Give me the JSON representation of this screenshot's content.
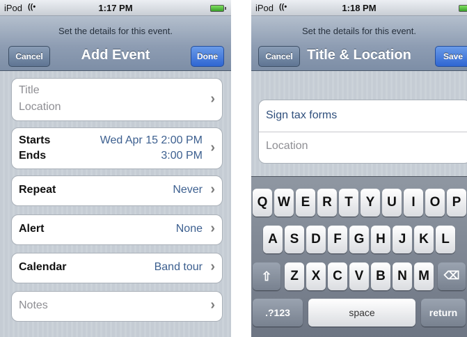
{
  "left": {
    "status": {
      "carrier": "iPod",
      "time": "1:17 PM"
    },
    "prompt": "Set the details for this event.",
    "title": "Add Event",
    "cancel": "Cancel",
    "done": "Done",
    "cells": {
      "title_placeholder": "Title",
      "location_placeholder": "Location",
      "starts_label": "Starts",
      "ends_label": "Ends",
      "starts_date": "Wed Apr 15",
      "starts_time": "2:00 PM",
      "ends_time": "3:00 PM",
      "repeat_label": "Repeat",
      "repeat_value": "Never",
      "alert_label": "Alert",
      "alert_value": "None",
      "calendar_label": "Calendar",
      "calendar_value": "Band tour",
      "notes_placeholder": "Notes"
    }
  },
  "right": {
    "status": {
      "carrier": "iPod",
      "time": "1:18 PM"
    },
    "prompt": "Set the details for this event.",
    "title": "Title & Location",
    "cancel": "Cancel",
    "save": "Save",
    "title_value": "Sign tax forms",
    "location_placeholder": "Location",
    "keyboard": {
      "row1": [
        "Q",
        "W",
        "E",
        "R",
        "T",
        "Y",
        "U",
        "I",
        "O",
        "P"
      ],
      "row2": [
        "A",
        "S",
        "D",
        "F",
        "G",
        "H",
        "J",
        "K",
        "L"
      ],
      "row3": [
        "Z",
        "X",
        "C",
        "V",
        "B",
        "N",
        "M"
      ],
      "numbers": ".?123",
      "space": "space",
      "return": "return"
    }
  }
}
